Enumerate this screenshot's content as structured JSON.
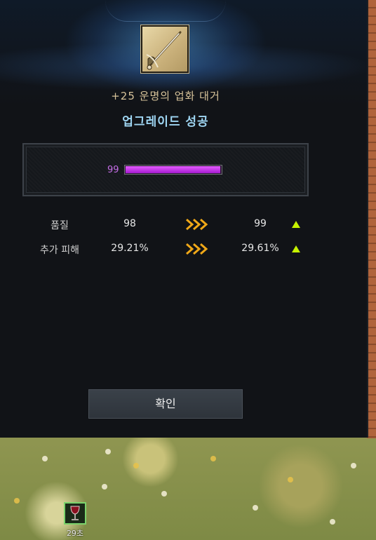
{
  "dialog": {
    "item_name": "+25 운명의 업화 대거",
    "result_text": "업그레이드 성공",
    "quality_bar": {
      "value_label": "99",
      "fill_fraction": 0.99,
      "color": "#c53ae8"
    },
    "stats": [
      {
        "label": "품질",
        "before": "98",
        "after": "99"
      },
      {
        "label": "추가 피해",
        "before": "29.21%",
        "after": "29.61%"
      }
    ],
    "confirm_label": "확인",
    "accent_up_color": "#c6f200",
    "arrow_color": "#f0a818"
  },
  "hud": {
    "buff_icon": "wine-glass-icon",
    "buff_time": "29초"
  }
}
